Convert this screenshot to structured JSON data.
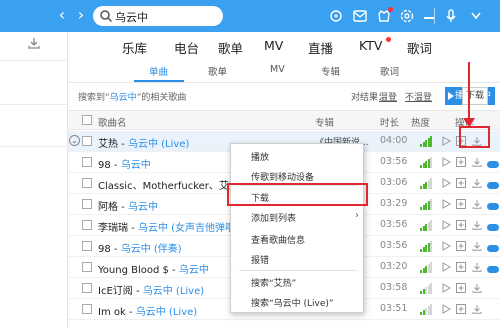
{
  "titlebar": {
    "search_value": "乌云中",
    "bg_color": "#3aa0f0"
  },
  "categories": [
    "乐库",
    "电台",
    "歌单",
    "MV",
    "直播",
    "KTV",
    "歌词"
  ],
  "subtabs": [
    "单曲",
    "歌单",
    "MV",
    "专辑",
    "歌词"
  ],
  "results": {
    "prefix": "搜索到“",
    "keyword": "乌云中",
    "suffix": "”的相关歌曲",
    "filter_label": "对结果：",
    "filter": "",
    "filter_link1": "温登",
    "filter_link2": "不温登",
    "play_button": "播放选中",
    "add_button": "添加",
    "download_button": "下载"
  },
  "table": {
    "headers": [
      "歌曲名",
      "专辑",
      "时长",
      "热度",
      "操作"
    ],
    "rows": [
      {
        "title": "艾热",
        "artist": "乌云中 (Live)",
        "album": "《中国新说...",
        "duration": "04:00",
        "highlighted": true
      },
      {
        "title": "98",
        "artist": "乌云中",
        "album": "",
        "duration": "03:56"
      },
      {
        "title": "Classic、Motherfucker、艾热",
        "artist": "",
        "album": "",
        "duration": "03:06"
      },
      {
        "title": "阿格",
        "artist": "乌云中",
        "album": "",
        "duration": "03:29"
      },
      {
        "title": "李瑞瑞",
        "artist": "乌云中 (女声吉他弹唱)",
        "album": "",
        "duration": "03:56"
      },
      {
        "title": "98",
        "artist": "乌云中 (伴奏)",
        "album": "",
        "duration": "03:56"
      },
      {
        "title": "Young Blood $",
        "artist": "乌云中",
        "album": "",
        "duration": "03:20"
      },
      {
        "title": "IcE订阅",
        "artist": "乌云中 (Live)",
        "album": "",
        "duration": "03:58"
      },
      {
        "title": "Im ok",
        "artist": "乌云中 (Live)",
        "album": "",
        "duration": "03:51"
      }
    ]
  },
  "context_menu": {
    "items": [
      "播放",
      "传歌到移动设备",
      "下载",
      "添加到列表",
      "查看歌曲信息",
      "报错",
      "搜索“艾热”",
      "搜索“乌云中 (Live)”"
    ]
  },
  "colors": {
    "accent": "#2c8fe6",
    "annotation_red": "#e0272f",
    "heat_green": "#4cba2c"
  },
  "icons": [
    "back-icon",
    "forward-icon",
    "search-icon",
    "skin-icon",
    "mail-icon",
    "gift-icon",
    "settings-icon",
    "minimize-icon",
    "download-icon",
    "play-icon",
    "add-icon"
  ]
}
